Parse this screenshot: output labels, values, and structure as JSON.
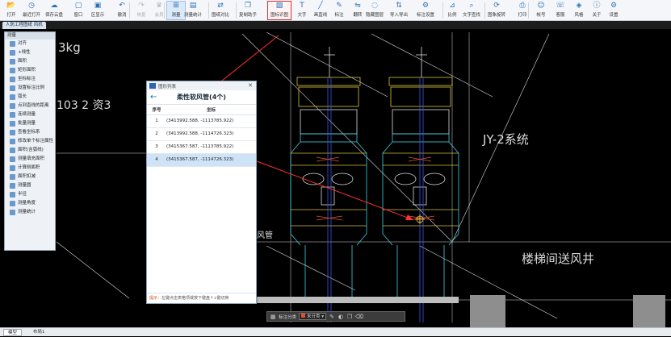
{
  "toolbar": {
    "items": [
      {
        "label": "打开",
        "icon": "folder-open-icon"
      },
      {
        "label": "最近打开",
        "icon": "clock-icon"
      },
      {
        "label": "保存云盘",
        "icon": "cloud-save-icon"
      },
      {
        "label": "窗口",
        "icon": "window-icon"
      },
      {
        "label": "区显示",
        "icon": "display-icon"
      },
      {
        "label": "撤消",
        "icon": "undo-icon"
      },
      {
        "label": "恢复",
        "icon": "redo-icon"
      },
      {
        "label": "会员",
        "icon": "vip-icon"
      },
      {
        "label": "测量",
        "icon": "measure-icon"
      },
      {
        "label": "测量统计",
        "icon": "table-icon"
      },
      {
        "label": "图纸对比",
        "icon": "compare-icon"
      },
      {
        "label": "复制助手",
        "icon": "copy-icon"
      },
      {
        "label": "图标识图",
        "icon": "image-icon"
      },
      {
        "label": "文字",
        "icon": "text-icon"
      },
      {
        "label": "画直线",
        "icon": "line-icon"
      },
      {
        "label": "标注",
        "icon": "annotate-icon"
      },
      {
        "label": "翻转",
        "icon": "flip-icon"
      },
      {
        "label": "隐藏图层",
        "icon": "hide-layer-icon"
      },
      {
        "label": "导入导出",
        "icon": "import-export-icon"
      },
      {
        "label": "标注设置",
        "icon": "annotate-settings-icon"
      },
      {
        "label": "比例",
        "icon": "scale-icon"
      },
      {
        "label": "文字查找",
        "icon": "search-icon"
      },
      {
        "label": "图象旋转",
        "icon": "rotate-icon"
      },
      {
        "label": "打印",
        "icon": "print-icon"
      },
      {
        "label": "帐号",
        "icon": "account-icon"
      },
      {
        "label": "客服",
        "icon": "headset-icon"
      },
      {
        "label": "风格",
        "icon": "style-icon"
      },
      {
        "label": "关于",
        "icon": "info-icon"
      },
      {
        "label": "设置",
        "icon": "settings-icon"
      }
    ]
  },
  "document_tab": {
    "label": "人防工程图纸 风机"
  },
  "drawing": {
    "text_kg": "3kg",
    "text_103": "103 2 资3",
    "text_jy2": "JY-2系统",
    "text_stair": "楼梯间送风井",
    "text_side": "风管"
  },
  "palette": {
    "title": "测量",
    "items": [
      "对齐",
      "+线性",
      "面积",
      "矩形面积",
      "坐标标注",
      "设置标注比例",
      "弧长",
      "点到直线的距离",
      "连续测量",
      "批量测量",
      "查看坐标系",
      "修改单个标注属性",
      "面积(含弧线)",
      "测量填充面积",
      "计算侧面积",
      "面积扣减",
      "测量圆",
      "半径",
      "测量角度",
      "测量统计"
    ]
  },
  "dialog": {
    "window_title": "图形列表",
    "title": "柔性软风管(4个)",
    "columns": [
      "序号",
      "坐标"
    ],
    "rows": [
      {
        "n": "1",
        "coord": "(3413992.588, -1113785.922)"
      },
      {
        "n": "2",
        "coord": "(3413992.588, -1114726.323)"
      },
      {
        "n": "3",
        "coord": "(3415367.587, -1113785.922)"
      },
      {
        "n": "4",
        "coord": "(3415367.587, -1114726.323)"
      }
    ],
    "selected_row": 4,
    "footer_label": "提示：",
    "footer_text": "左键点击表格项或按下键盘↑↓键切换"
  },
  "floatbar": {
    "label": "标注分类",
    "dropdown": "未分类"
  },
  "status_tabs": [
    "模型",
    "布局1"
  ],
  "colors": {
    "accent": "#2a6fb8",
    "highlight": "#e03030",
    "cad_yellow": "#d8c23a",
    "cad_cyan": "#3ad1e6",
    "cad_blue": "#3e55e8"
  }
}
